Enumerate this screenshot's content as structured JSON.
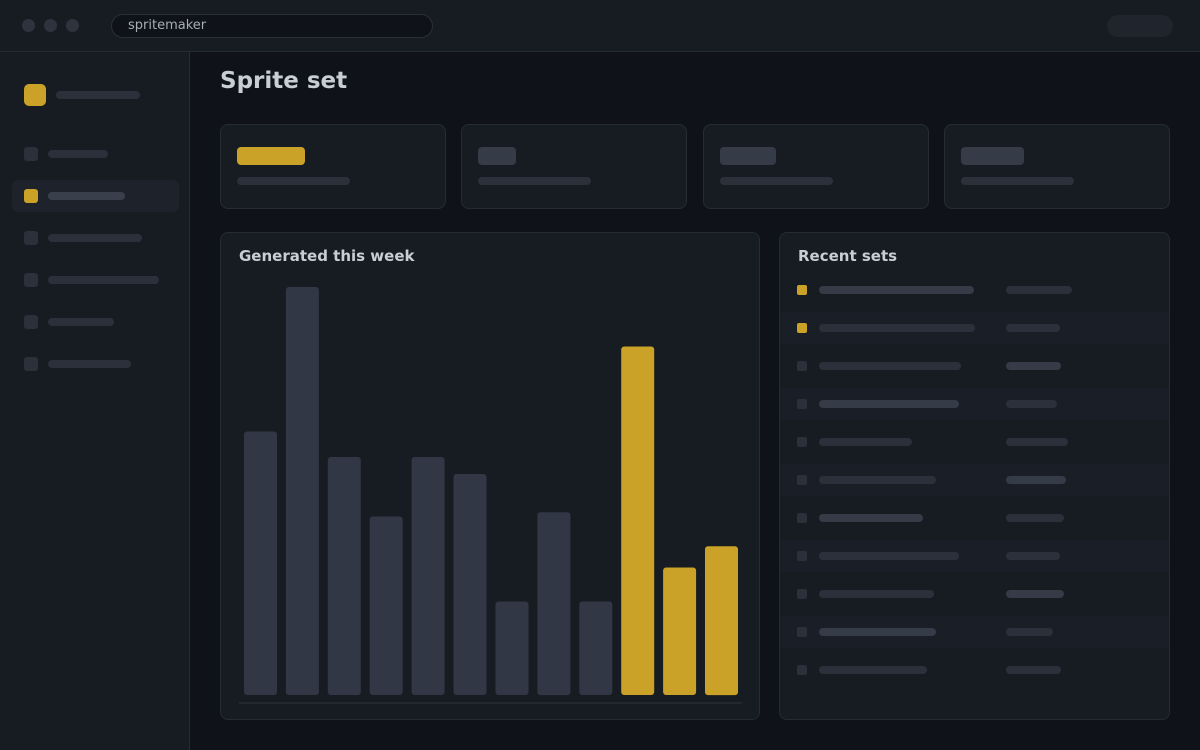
{
  "browser": {
    "address": "spritemaker"
  },
  "page": {
    "title": "Sprite set"
  },
  "chart_panel": {
    "title": "Generated this week"
  },
  "recent_panel": {
    "title": "Recent sets"
  },
  "colors": {
    "accent": "#c9a227",
    "bar": "#313744",
    "background": "#0f1218",
    "panel": "#171b22"
  },
  "chart_data": {
    "type": "bar",
    "title": "Generated this week",
    "values": [
      62,
      96,
      56,
      42,
      56,
      52,
      22,
      43,
      22,
      82,
      30,
      35
    ],
    "highlighted": [
      false,
      false,
      false,
      false,
      false,
      false,
      false,
      false,
      false,
      true,
      true,
      true
    ],
    "ylim": [
      0,
      100
    ],
    "grid": false
  }
}
